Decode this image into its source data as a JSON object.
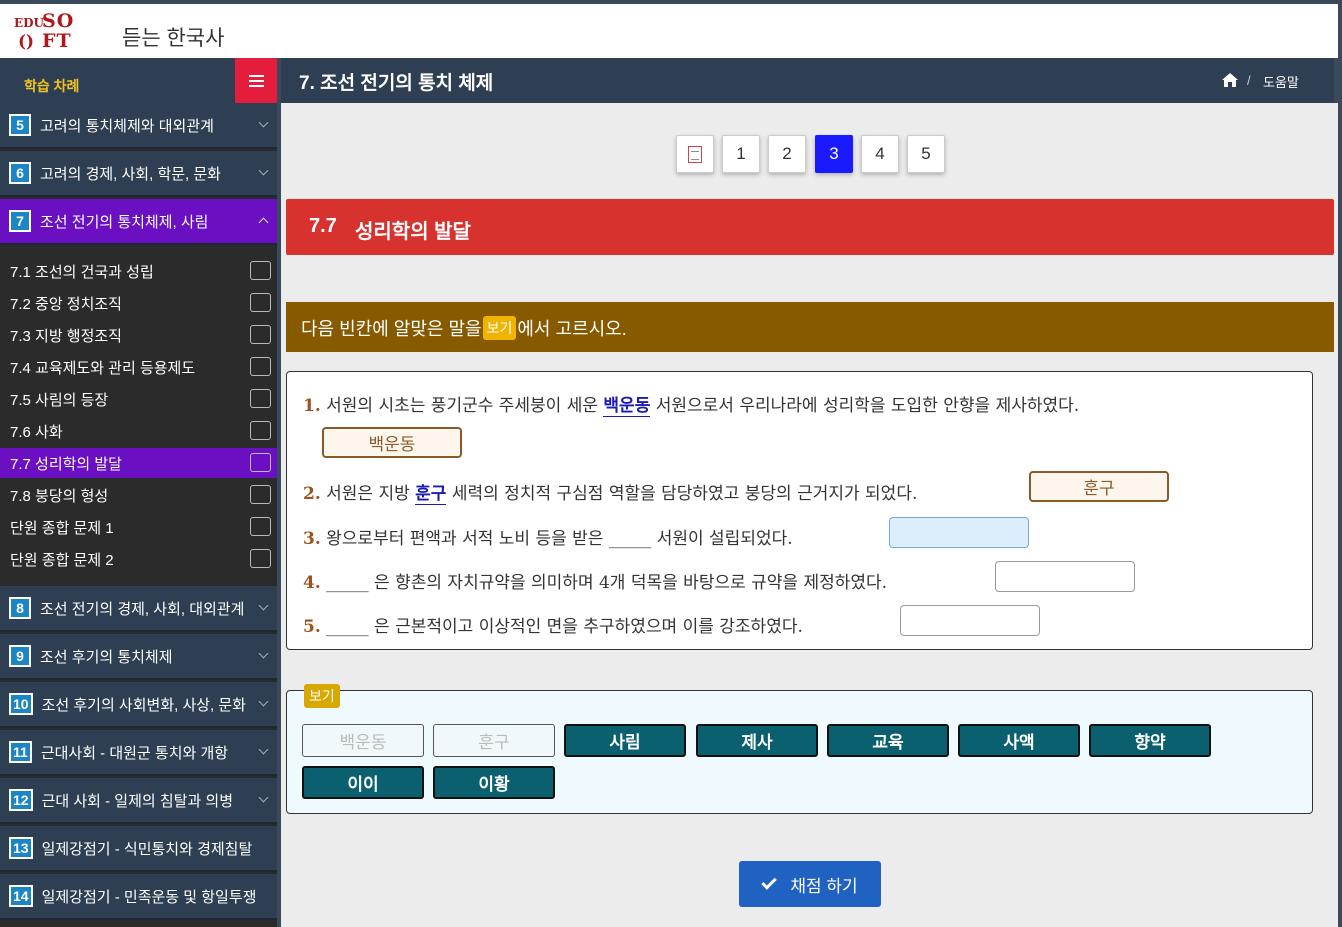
{
  "header": {
    "logo_parts": [
      "EDU",
      "SO",
      "()",
      "FT"
    ],
    "app_title": "듣는 한국사"
  },
  "sidebar": {
    "heading": "학습 차례",
    "chapters_top": [
      {
        "num": "5",
        "title": "고려의 통치체제와 대외관계"
      },
      {
        "num": "6",
        "title": "고려의 경제, 사회, 학문, 문화"
      },
      {
        "num": "7",
        "title": "조선 전기의 통치체제, 사림"
      }
    ],
    "sub_items": [
      "7.1 조선의 건국과 성립",
      "7.2 중앙 정치조직",
      "7.3 지방 행정조직",
      "7.4 교육제도와 관리 등용제도",
      "7.5 사림의 등장",
      "7.6 사화",
      "7.7 성리학의 발달",
      "7.8 붕당의 형성",
      "단원 종합 문제 1",
      "단원 종합 문제 2"
    ],
    "chapters_bottom": [
      {
        "num": "8",
        "title": "조선 전기의 경제, 사회, 대외관계"
      },
      {
        "num": "9",
        "title": "조선 후기의 통치체제"
      },
      {
        "num": "10",
        "title": "조선 후기의 사회변화, 사상, 문화"
      },
      {
        "num": "11",
        "title": "근대사회 - 대원군 통치와 개항"
      },
      {
        "num": "12",
        "title": "근대 사회 - 일제의 침탈과 의병"
      },
      {
        "num": "13",
        "title": "일제강점기 - 식민통치와 경제침탈"
      },
      {
        "num": "14",
        "title": "일제강점기 - 민족운동 및 항일투쟁"
      }
    ]
  },
  "main_header": {
    "title": "7. 조선 전기의 통치 체제",
    "sep": "/",
    "help": "도움말"
  },
  "pagination": {
    "pages": [
      "1",
      "2",
      "3",
      "4",
      "5"
    ],
    "current": "3"
  },
  "section": {
    "num": "7.7",
    "title": "성리학의 발달"
  },
  "instruction": {
    "before": "다음 빈칸에 알맞은 말을 ",
    "tag": "보기",
    "after": "에서 고르시오."
  },
  "questions": {
    "q1": {
      "num": "1.",
      "pre": " 서원의 시초는 풍기군수 주세붕이 세운 ",
      "hl": "백운동",
      "post": " 서원으로서 우리나라에 성리학을 도입한 안향을 제사하였다.",
      "answer": "백운동"
    },
    "q2": {
      "num": "2.",
      "pre": " 서원은 지방 ",
      "hl": "훈구",
      "post": " 세력의 정치적 구심점 역할을 담당하였고 붕당의 근거지가 되었다.",
      "answer": "훈구"
    },
    "q3": {
      "num": "3.",
      "text": " 왕으로부터 편액과 서적 노비 등을 받은 _____ 서원이 설립되었다.",
      "answer": ""
    },
    "q4": {
      "num": "4.",
      "text": " _____ 은 향촌의 자치규약을 의미하며 4개 덕목을 바탕으로 규약을 제정하였다.",
      "answer": ""
    },
    "q5": {
      "num": "5.",
      "text": " _____ 은 근본적이고 이상적인 면을 추구하였으며 이를 강조하였다.",
      "answer": ""
    }
  },
  "bogi": {
    "tag": "보기",
    "options": [
      "백운동",
      "훈구",
      "사림",
      "제사",
      "교육",
      "사액",
      "향약",
      "이이",
      "이황"
    ]
  },
  "grade_button": "채점 하기"
}
